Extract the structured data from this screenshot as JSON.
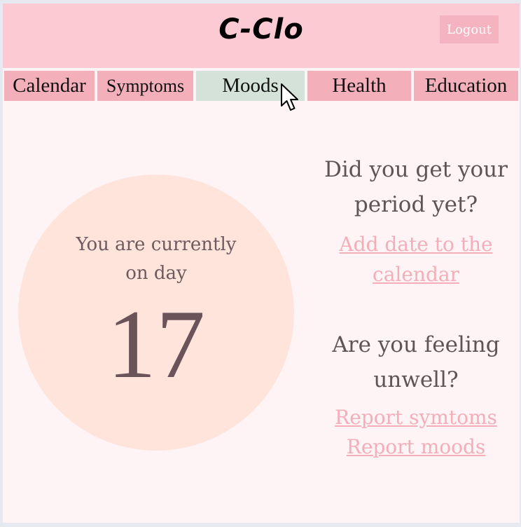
{
  "header": {
    "brand": "C-Clo",
    "logout_label": "Logout"
  },
  "nav": {
    "items": [
      {
        "label": "Calendar"
      },
      {
        "label": "Symptoms"
      },
      {
        "label": "Moods"
      },
      {
        "label": "Health"
      },
      {
        "label": "Education"
      }
    ],
    "active": "Moods"
  },
  "cycle": {
    "text_line1": "You are currently",
    "text_line2": "on day",
    "day": "17"
  },
  "period": {
    "question_line1": "Did you get your",
    "question_line2": "period yet?",
    "link_line1": "Add date to the",
    "link_line2": "calendar"
  },
  "unwell": {
    "question_line1": "Are you feeling",
    "question_line2": "unwell?",
    "report_symptoms": "Report symtoms",
    "report_moods": "Report moods"
  },
  "colors": {
    "header": "#fccad3",
    "nav": "#f3b0bb",
    "nav_active": "#d4e2da",
    "circle": "#ffe4dc",
    "link": "#f3aeb9",
    "background": "#fef4f5"
  },
  "icons": {
    "cursor": "mouse-pointer-icon"
  }
}
